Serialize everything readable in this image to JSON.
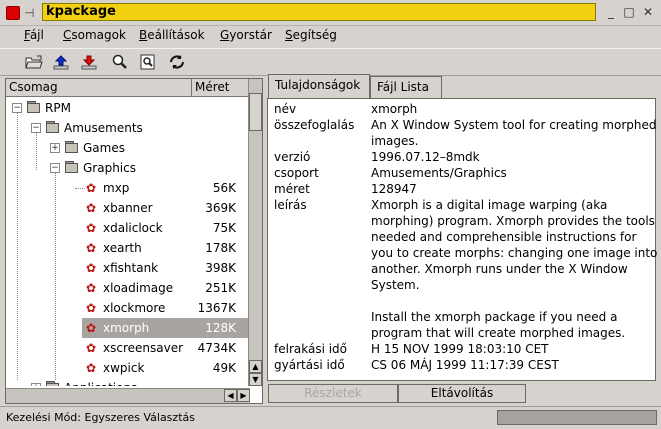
{
  "window": {
    "title": "kpackage",
    "pin_icon": "pin-icon",
    "app_icon": "kde-app-icon",
    "buttons": [
      "minimize",
      "maximize",
      "close"
    ]
  },
  "menu": [
    {
      "label": "Fájl",
      "underline": "F",
      "rest": "ájl"
    },
    {
      "label": "Csomagok",
      "underline": "C",
      "rest": "somagok"
    },
    {
      "label": "Beállítások",
      "underline": "B",
      "rest": "eállítások"
    },
    {
      "label": "Gyorstár",
      "underline": "G",
      "rest": "yorstár"
    },
    {
      "label": "Segítség",
      "underline": "S",
      "rest": "egítség"
    }
  ],
  "toolbar": [
    "open-icon",
    "install-icon",
    "uninstall-icon",
    "find-icon",
    "find-file-icon",
    "reload-icon"
  ],
  "tree": {
    "headers": {
      "name": "Csomag",
      "size": "Méret"
    },
    "nodes": [
      {
        "label": "RPM",
        "type": "folder",
        "level": 0,
        "expander": "−"
      },
      {
        "label": "Amusements",
        "type": "folder",
        "level": 1,
        "expander": "−"
      },
      {
        "label": "Games",
        "type": "folder",
        "level": 2,
        "expander": "+"
      },
      {
        "label": "Graphics",
        "type": "folder",
        "level": 2,
        "expander": "−"
      },
      {
        "label": "mxp",
        "type": "package",
        "level": 3,
        "size": "56K"
      },
      {
        "label": "xbanner",
        "type": "package",
        "level": 3,
        "size": "369K"
      },
      {
        "label": "xdaliclock",
        "type": "package",
        "level": 3,
        "size": "75K"
      },
      {
        "label": "xearth",
        "type": "package",
        "level": 3,
        "size": "178K"
      },
      {
        "label": "xfishtank",
        "type": "package",
        "level": 3,
        "size": "398K"
      },
      {
        "label": "xloadimage",
        "type": "package",
        "level": 3,
        "size": "251K"
      },
      {
        "label": "xlockmore",
        "type": "package",
        "level": 3,
        "size": "1367K"
      },
      {
        "label": "xmorph",
        "type": "package",
        "level": 3,
        "size": "128K",
        "selected": true
      },
      {
        "label": "xscreensaver",
        "type": "package",
        "level": 3,
        "size": "4734K"
      },
      {
        "label": "xwpick",
        "type": "package",
        "level": 3,
        "size": "49K"
      },
      {
        "label": "Applications",
        "type": "folder",
        "level": 1,
        "expander": "+"
      }
    ]
  },
  "tabs": {
    "properties": "Tulajdonságok",
    "files": "Fájl Lista"
  },
  "properties": [
    {
      "key": "név",
      "lines": [
        "xmorph"
      ]
    },
    {
      "key": "összefoglalás",
      "lines": [
        "An X Window System tool for creating morphed",
        "images."
      ]
    },
    {
      "key": "verzió",
      "lines": [
        "1996.07.12–8mdk"
      ]
    },
    {
      "key": "csoport",
      "lines": [
        "Amusements/Graphics"
      ]
    },
    {
      "key": "méret",
      "lines": [
        "128947"
      ]
    },
    {
      "key": "leírás",
      "lines": [
        "Xmorph is a digital image warping (aka",
        "morphing) program.  Xmorph provides the tools",
        "needed and comprehensible instructions for",
        "you to create morphs:  changing one image into",
        "another.  Xmorph runs under the X Window",
        "System.",
        "",
        "Install the xmorph package if you need a",
        "program that will create morphed images."
      ]
    },
    {
      "key": "felrakási idő",
      "lines": [
        "H 15 NOV 1999 18:03:10 CET"
      ]
    },
    {
      "key": "gyártási idő",
      "lines": [
        "CS 06 MÁJ 1999 11:17:39 CEST"
      ]
    }
  ],
  "buttons": {
    "details": "Részletek",
    "uninstall": "Eltávolítás"
  },
  "status": {
    "text": "Kezelési Mód: Egyszeres Választás"
  }
}
